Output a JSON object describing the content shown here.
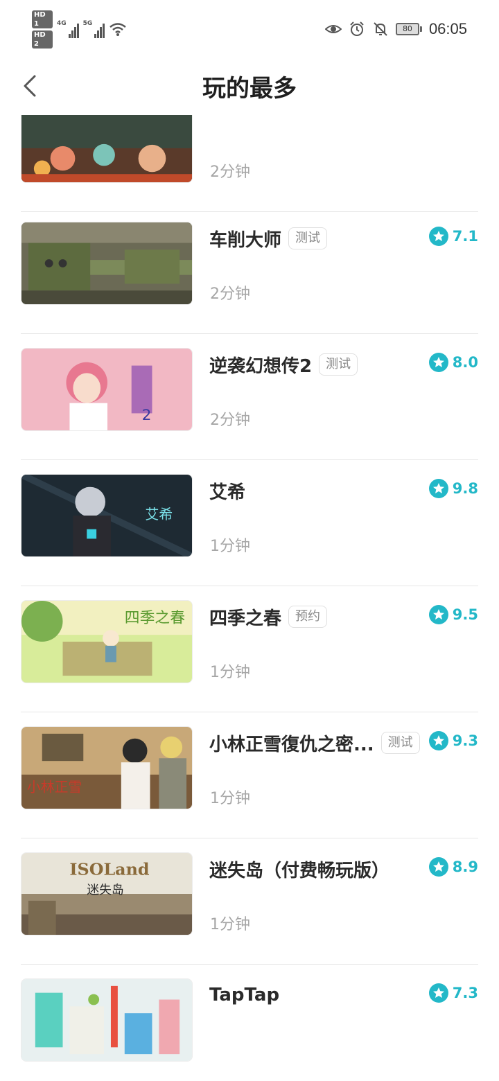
{
  "status_bar": {
    "hd1": "HD 1",
    "hd2": "HD 2",
    "net1": "4G",
    "net2": "5G",
    "battery": "80",
    "time": "06:05"
  },
  "header": {
    "title": "玩的最多"
  },
  "accent_color": "#23b8c8",
  "games": [
    {
      "name": "",
      "tag": "",
      "duration": "2分钟",
      "rating": "",
      "icon": "game-thumbnail-party"
    },
    {
      "name": "车削大师",
      "tag": "测试",
      "duration": "2分钟",
      "rating": "7.1",
      "icon": "game-thumbnail-lathe"
    },
    {
      "name": "逆袭幻想传2",
      "tag": "测试",
      "duration": "2分钟",
      "rating": "8.0",
      "icon": "game-thumbnail-anime-pink"
    },
    {
      "name": "艾希",
      "tag": "",
      "duration": "1分钟",
      "rating": "9.8",
      "icon": "game-thumbnail-icey"
    },
    {
      "name": "四季之春",
      "tag": "预约",
      "duration": "1分钟",
      "rating": "9.5",
      "icon": "game-thumbnail-spring"
    },
    {
      "name": "小林正雪復仇之密...",
      "tag": "测试",
      "duration": "1分钟",
      "rating": "9.3",
      "icon": "game-thumbnail-kobayashi"
    },
    {
      "name": "迷失岛（付费畅玩版）",
      "tag": "",
      "duration": "1分钟",
      "rating": "8.9",
      "icon": "game-thumbnail-isoland"
    },
    {
      "name": "TapTap",
      "tag": "",
      "duration": "",
      "rating": "7.3",
      "icon": "game-thumbnail-city"
    }
  ]
}
